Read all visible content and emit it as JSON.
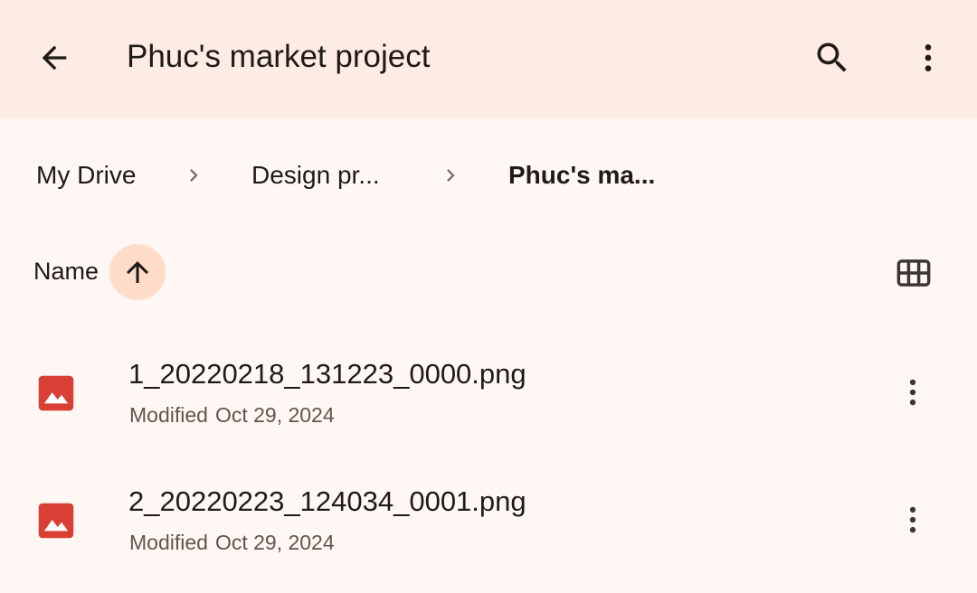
{
  "header": {
    "title": "Phuc's market project",
    "back_icon": "arrow-back-icon",
    "search_icon": "search-icon",
    "more_icon": "more-vert-icon",
    "background": "#fdece3"
  },
  "breadcrumb": {
    "items": [
      {
        "label": "My Drive"
      },
      {
        "label": "Design pr..."
      },
      {
        "label": "Phuc's ma..."
      }
    ]
  },
  "sort": {
    "label": "Name",
    "direction_icon": "arrow-upward-icon",
    "view_toggle_icon": "grid-view-icon",
    "accent": "#ffdbc9"
  },
  "files": [
    {
      "name": "1_20220218_131223_0000.png",
      "modified_label": "Modified",
      "modified_date": "Oct 29, 2024",
      "icon": "image-file-icon",
      "icon_color": "#d93f34"
    },
    {
      "name": "2_20220223_124034_0001.png",
      "modified_label": "Modified",
      "modified_date": "Oct 29, 2024",
      "icon": "image-file-icon",
      "icon_color": "#d93f34"
    }
  ]
}
